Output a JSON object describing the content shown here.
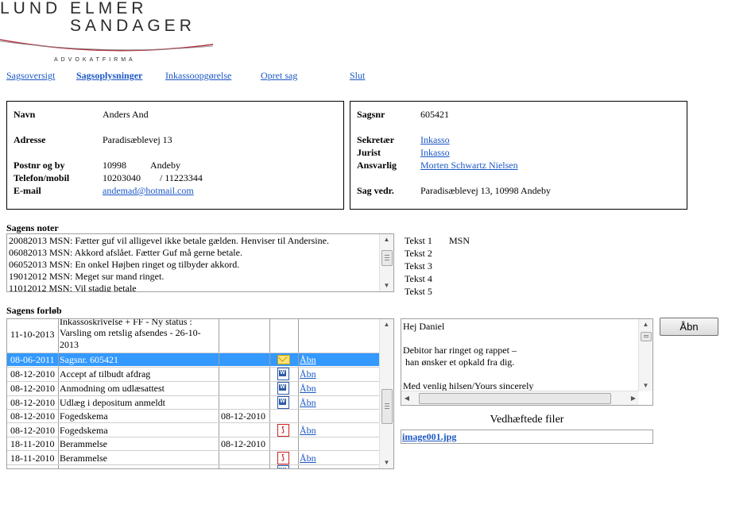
{
  "logo": {
    "line1": "LUND ELMER",
    "line2": "SANDAGER",
    "sub": "ADVOKATFIRMA"
  },
  "nav": {
    "items": [
      "Sagsoversigt",
      "Sagsoplysninger",
      "Inkassoopgørelse",
      "Opret sag",
      "Slut"
    ],
    "active": "Sagsoplysninger"
  },
  "debtor": {
    "name_label": "Navn",
    "name": "Anders And",
    "address_label": "Adresse",
    "address": "Paradisæblevej 13",
    "postal_label": "Postnr og by",
    "postal_code": "10998",
    "city": "Andeby",
    "phone_label": "Telefon/mobil",
    "phone": "10203040",
    "mobile": "/ 11223344",
    "email_label": "E-mail",
    "email": "andemad@hotmail.com"
  },
  "case": {
    "number_label": "Sagsnr",
    "number": "605421",
    "secretary_label": "Sekretær",
    "secretary": "Inkasso",
    "lawyer_label": "Jurist",
    "lawyer": "Inkasso",
    "responsible_label": "Ansvarlig",
    "responsible": "Morten Schwartz Nielsen",
    "regarding_label": "Sag vedr.",
    "regarding": "Paradisæblevej 13, 10998 Andeby"
  },
  "notes": {
    "title": "Sagens noter",
    "lines": [
      "20082013 MSN: Fætter guf vil alligevel ikke betale gælden. Henviser til Andersine.",
      "06082013 MSN: Akkord afslået. Fætter Guf må gerne betale.",
      "06052013 MSN: En onkel Højben ringet og tilbyder akkord.",
      "19012012 MSN: Meget sur mand ringet.",
      "11012012 MSN: Vil stadig betale"
    ]
  },
  "tekst": {
    "items": [
      {
        "label": "Tekst 1",
        "value": "MSN"
      },
      {
        "label": "Tekst 2",
        "value": ""
      },
      {
        "label": "Tekst 3",
        "value": ""
      },
      {
        "label": "Tekst 4",
        "value": ""
      },
      {
        "label": "Tekst 5",
        "value": ""
      }
    ]
  },
  "forlob": {
    "title": "Sagens forløb",
    "rows": [
      {
        "date": "",
        "desc": "Inkassoskrivelse + FF - Ny status :",
        "date2": "",
        "icon": "",
        "link": ""
      },
      {
        "date": "11-10-2013",
        "desc": "Varsling om retslig afsendes - 26-10-",
        "date2": "",
        "icon": "",
        "link": ""
      },
      {
        "date": "",
        "desc": "2013",
        "date2": "",
        "icon": "",
        "link": ""
      },
      {
        "date": "08-06-2011",
        "desc": "Sagsnr. 605421",
        "date2": "",
        "icon": "mail-icon",
        "link": "Åbn"
      },
      {
        "date": "08-12-2010",
        "desc": "Accept af tilbudt afdrag",
        "date2": "",
        "icon": "word-doc-icon",
        "link": "Åbn"
      },
      {
        "date": "08-12-2010",
        "desc": "Anmodning om udlæsattest",
        "date2": "",
        "icon": "word-doc-icon",
        "link": "Åbn"
      },
      {
        "date": "08-12-2010",
        "desc": "Udlæg i depositum anmeldt",
        "date2": "",
        "icon": "word-doc-icon",
        "link": "Åbn"
      },
      {
        "date": "08-12-2010",
        "desc": "Fogedskema",
        "date2": "08-12-2010",
        "icon": "",
        "link": ""
      },
      {
        "date": "08-12-2010",
        "desc": "Fogedskema",
        "date2": "",
        "icon": "pdf-icon",
        "link": "Åbn"
      },
      {
        "date": "18-11-2010",
        "desc": "Berammelse",
        "date2": "08-12-2010",
        "icon": "",
        "link": ""
      },
      {
        "date": "18-11-2010",
        "desc": "Berammelse",
        "date2": "",
        "icon": "pdf-icon",
        "link": "Åbn"
      },
      {
        "date": "",
        "desc": "",
        "date2": "",
        "icon": "word-doc-icon",
        "link": ""
      }
    ],
    "selected_row": 3
  },
  "message": {
    "text": "Hej Daniel\n\nDebitor har ringet og rappet –\n han ønsker et opkald fra dig.\n\nMed venlig hilsen/Yours sincerely"
  },
  "open_button": "Åbn",
  "attachments": {
    "title": "Vedhæftede filer",
    "files": [
      "image001.jpg"
    ]
  },
  "colors": {
    "link": "#1a56c4",
    "selection": "#3399ff",
    "logo_arc": "#b03040"
  }
}
